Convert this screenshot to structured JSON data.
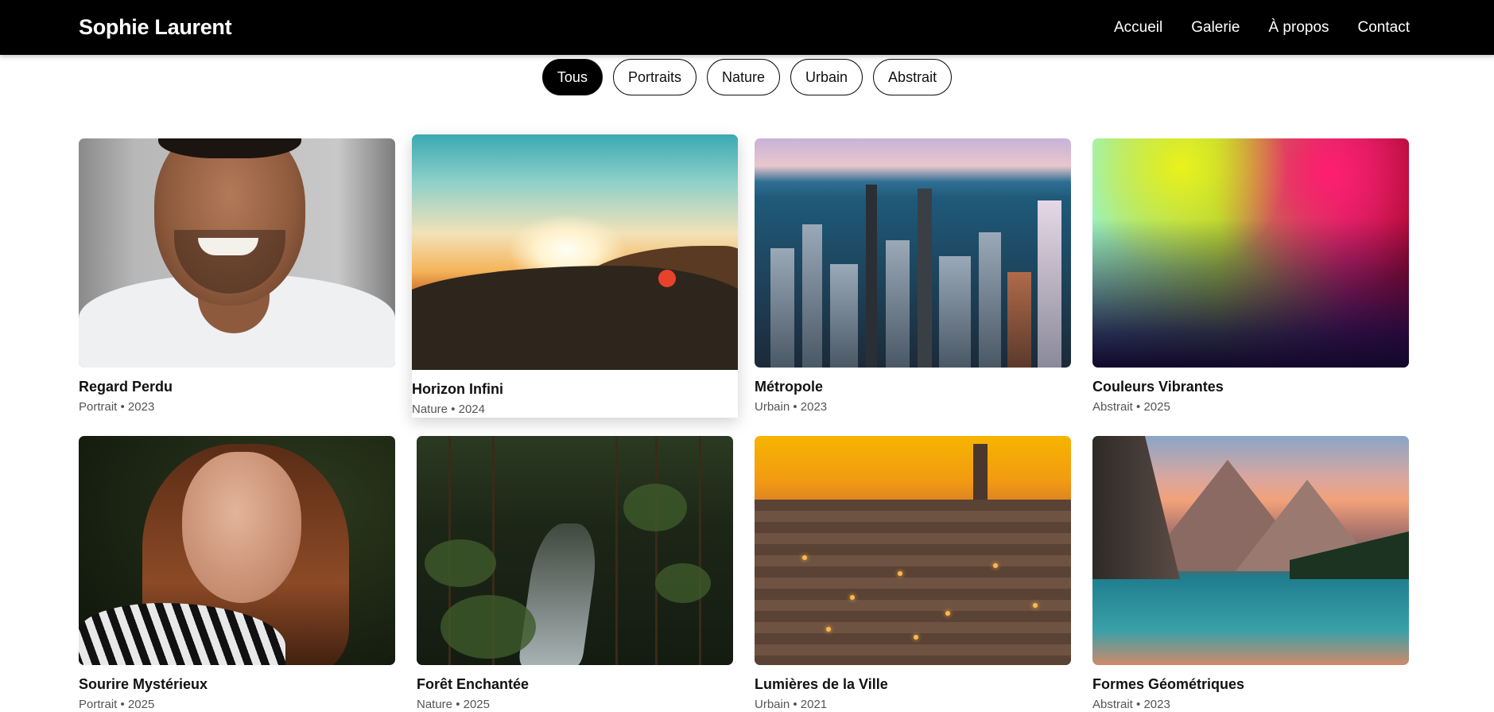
{
  "header": {
    "brand": "Sophie Laurent",
    "nav": [
      "Accueil",
      "Galerie",
      "À propos",
      "Contact"
    ]
  },
  "filters": [
    {
      "label": "Tous",
      "active": true
    },
    {
      "label": "Portraits",
      "active": false
    },
    {
      "label": "Nature",
      "active": false
    },
    {
      "label": "Urbain",
      "active": false
    },
    {
      "label": "Abstrait",
      "active": false
    }
  ],
  "gallery": [
    {
      "title": "Regard Perdu",
      "meta": "Portrait • 2023"
    },
    {
      "title": "Horizon Infini",
      "meta": "Nature • 2024"
    },
    {
      "title": "Métropole",
      "meta": "Urbain • 2023"
    },
    {
      "title": "Couleurs Vibrantes",
      "meta": "Abstrait • 2025"
    },
    {
      "title": "Sourire Mystérieux",
      "meta": "Portrait • 2025"
    },
    {
      "title": "Forêt Enchantée",
      "meta": "Nature • 2025"
    },
    {
      "title": "Lumières de la Ville",
      "meta": "Urbain • 2021"
    },
    {
      "title": "Formes Géométriques",
      "meta": "Abstrait • 2023"
    }
  ]
}
